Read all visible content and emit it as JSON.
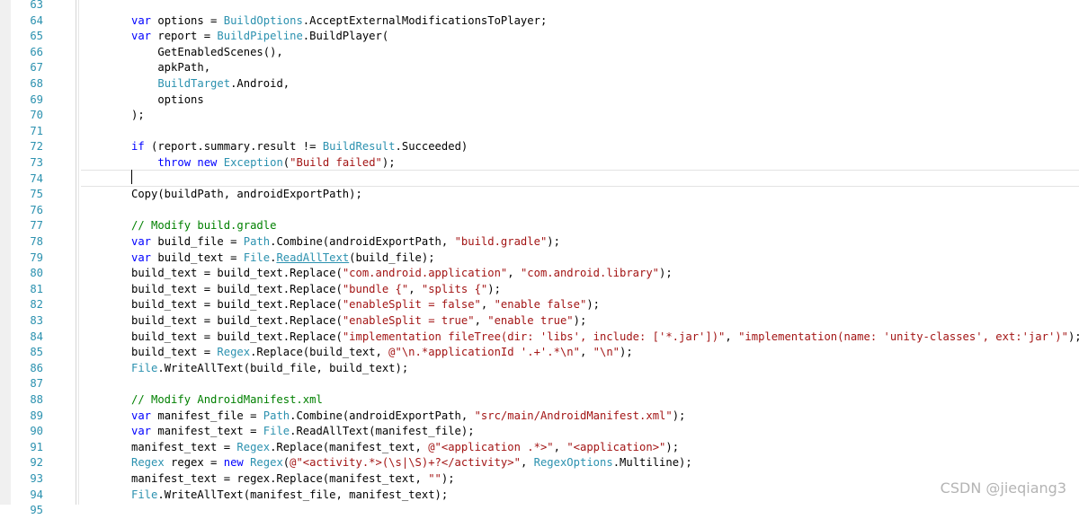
{
  "editor": {
    "colors": {
      "keyword": "#0000ff",
      "type": "#2b91af",
      "string": "#a31515",
      "comment": "#008000",
      "plain": "#000000",
      "line_number": "#2b91af"
    },
    "lines": [
      {
        "n": "63",
        "segs": []
      },
      {
        "n": "64",
        "segs": [
          [
            "k",
            "var"
          ],
          [
            "p",
            " options = "
          ],
          [
            "t",
            "BuildOptions"
          ],
          [
            "p",
            ".AcceptExternalModificationsToPlayer;"
          ]
        ]
      },
      {
        "n": "65",
        "segs": [
          [
            "k",
            "var"
          ],
          [
            "p",
            " report = "
          ],
          [
            "t",
            "BuildPipeline"
          ],
          [
            "p",
            ".BuildPlayer("
          ]
        ]
      },
      {
        "n": "66",
        "segs": [
          [
            "p",
            "    GetEnabledScenes(),"
          ]
        ]
      },
      {
        "n": "67",
        "segs": [
          [
            "p",
            "    apkPath,"
          ]
        ]
      },
      {
        "n": "68",
        "segs": [
          [
            "p",
            "    "
          ],
          [
            "t",
            "BuildTarget"
          ],
          [
            "p",
            ".Android,"
          ]
        ]
      },
      {
        "n": "69",
        "segs": [
          [
            "p",
            "    options"
          ]
        ]
      },
      {
        "n": "70",
        "segs": [
          [
            "p",
            ");"
          ]
        ]
      },
      {
        "n": "71",
        "segs": []
      },
      {
        "n": "72",
        "segs": [
          [
            "k",
            "if"
          ],
          [
            "p",
            " (report.summary.result != "
          ],
          [
            "t",
            "BuildResult"
          ],
          [
            "p",
            ".Succeeded)"
          ]
        ]
      },
      {
        "n": "73",
        "segs": [
          [
            "p",
            "    "
          ],
          [
            "k",
            "throw new"
          ],
          [
            "p",
            " "
          ],
          [
            "t",
            "Exception"
          ],
          [
            "p",
            "("
          ],
          [
            "s",
            "\"Build failed\""
          ],
          [
            "p",
            ");"
          ]
        ]
      },
      {
        "n": "74",
        "segs": []
      },
      {
        "n": "75",
        "segs": [
          [
            "p",
            "Copy(buildPath, androidExportPath);"
          ]
        ]
      },
      {
        "n": "76",
        "segs": []
      },
      {
        "n": "77",
        "segs": [
          [
            "c",
            "// Modify build.gradle"
          ]
        ]
      },
      {
        "n": "78",
        "segs": [
          [
            "k",
            "var"
          ],
          [
            "p",
            " build_file = "
          ],
          [
            "t",
            "Path"
          ],
          [
            "p",
            ".Combine(androidExportPath, "
          ],
          [
            "s",
            "\"build.gradle\""
          ],
          [
            "p",
            ");"
          ]
        ]
      },
      {
        "n": "79",
        "segs": [
          [
            "k",
            "var"
          ],
          [
            "p",
            " build_text = "
          ],
          [
            "t",
            "File"
          ],
          [
            "p",
            "."
          ],
          [
            "u",
            "ReadAllText"
          ],
          [
            "p",
            "(build_file);"
          ]
        ]
      },
      {
        "n": "80",
        "segs": [
          [
            "p",
            "build_text = build_text.Replace("
          ],
          [
            "s",
            "\"com.android.application\""
          ],
          [
            "p",
            ", "
          ],
          [
            "s",
            "\"com.android.library\""
          ],
          [
            "p",
            ");"
          ]
        ]
      },
      {
        "n": "81",
        "segs": [
          [
            "p",
            "build_text = build_text.Replace("
          ],
          [
            "s",
            "\"bundle {\""
          ],
          [
            "p",
            ", "
          ],
          [
            "s",
            "\"splits {\""
          ],
          [
            "p",
            ");"
          ]
        ]
      },
      {
        "n": "82",
        "segs": [
          [
            "p",
            "build_text = build_text.Replace("
          ],
          [
            "s",
            "\"enableSplit = false\""
          ],
          [
            "p",
            ", "
          ],
          [
            "s",
            "\"enable false\""
          ],
          [
            "p",
            ");"
          ]
        ]
      },
      {
        "n": "83",
        "segs": [
          [
            "p",
            "build_text = build_text.Replace("
          ],
          [
            "s",
            "\"enableSplit = true\""
          ],
          [
            "p",
            ", "
          ],
          [
            "s",
            "\"enable true\""
          ],
          [
            "p",
            ");"
          ]
        ]
      },
      {
        "n": "84",
        "segs": [
          [
            "p",
            "build_text = build_text.Replace("
          ],
          [
            "s",
            "\"implementation fileTree(dir: 'libs', include: ['*.jar'])\""
          ],
          [
            "p",
            ", "
          ],
          [
            "s",
            "\"implementation(name: 'unity-classes', ext:'jar')\""
          ],
          [
            "p",
            ");"
          ]
        ]
      },
      {
        "n": "85",
        "segs": [
          [
            "p",
            "build_text = "
          ],
          [
            "t",
            "Regex"
          ],
          [
            "p",
            ".Replace(build_text, "
          ],
          [
            "s",
            "@\"\\n.*applicationId '.+'.*\\n\""
          ],
          [
            "p",
            ", "
          ],
          [
            "s",
            "\"\\n\""
          ],
          [
            "p",
            ");"
          ]
        ]
      },
      {
        "n": "86",
        "segs": [
          [
            "t",
            "File"
          ],
          [
            "p",
            ".WriteAllText(build_file, build_text);"
          ]
        ]
      },
      {
        "n": "87",
        "segs": []
      },
      {
        "n": "88",
        "segs": [
          [
            "c",
            "// Modify AndroidManifest.xml"
          ]
        ]
      },
      {
        "n": "89",
        "segs": [
          [
            "k",
            "var"
          ],
          [
            "p",
            " manifest_file = "
          ],
          [
            "t",
            "Path"
          ],
          [
            "p",
            ".Combine(androidExportPath, "
          ],
          [
            "s",
            "\"src/main/AndroidManifest.xml\""
          ],
          [
            "p",
            ");"
          ]
        ]
      },
      {
        "n": "90",
        "segs": [
          [
            "k",
            "var"
          ],
          [
            "p",
            " manifest_text = "
          ],
          [
            "t",
            "File"
          ],
          [
            "p",
            ".ReadAllText(manifest_file);"
          ]
        ]
      },
      {
        "n": "91",
        "segs": [
          [
            "p",
            "manifest_text = "
          ],
          [
            "t",
            "Regex"
          ],
          [
            "p",
            ".Replace(manifest_text, "
          ],
          [
            "s",
            "@\"<application .*>\""
          ],
          [
            "p",
            ", "
          ],
          [
            "s",
            "\"<application>\""
          ],
          [
            "p",
            ");"
          ]
        ]
      },
      {
        "n": "92",
        "segs": [
          [
            "t",
            "Regex"
          ],
          [
            "p",
            " regex = "
          ],
          [
            "k",
            "new"
          ],
          [
            "p",
            " "
          ],
          [
            "t",
            "Regex"
          ],
          [
            "p",
            "("
          ],
          [
            "s",
            "@\"<activity.*>(\\s|\\S)+?</activity>\""
          ],
          [
            "p",
            ", "
          ],
          [
            "t",
            "RegexOptions"
          ],
          [
            "p",
            ".Multiline);"
          ]
        ]
      },
      {
        "n": "93",
        "segs": [
          [
            "p",
            "manifest_text = regex.Replace(manifest_text, "
          ],
          [
            "s",
            "\"\""
          ],
          [
            "p",
            ");"
          ]
        ]
      },
      {
        "n": "94",
        "segs": [
          [
            "t",
            "File"
          ],
          [
            "p",
            ".WriteAllText(manifest_file, manifest_text);"
          ]
        ]
      },
      {
        "n": "95",
        "segs": []
      }
    ]
  },
  "watermark": "CSDN @jieqiang3"
}
